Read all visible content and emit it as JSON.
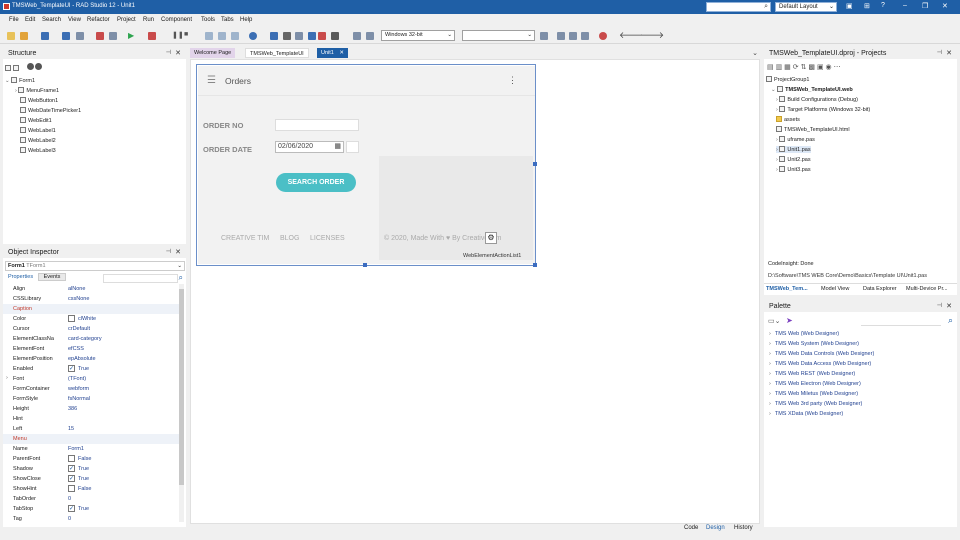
{
  "window": {
    "title": "TMSWeb_TemplateUI - RAD Studio 12 - Unit1"
  },
  "title_search": {
    "placeholder": ""
  },
  "layout": {
    "selected": "Default Layout"
  },
  "menu": [
    "File",
    "Edit",
    "Search",
    "View",
    "Refactor",
    "Project",
    "Run",
    "Component",
    "Tools",
    "Tabs",
    "Help"
  ],
  "toolbar": {
    "platform": "Windows 32-bit",
    "config": ""
  },
  "structure": {
    "title": "Structure",
    "items": [
      "Form1",
      "MenuFrame1",
      "WebButton1",
      "WebDateTimePicker1",
      "WebEdit1",
      "WebLabel1",
      "WebLabel2",
      "WebLabel3"
    ]
  },
  "object_inspector": {
    "title": "Object Inspector",
    "selected": "Form1",
    "selected_type": "TForm1",
    "tabs": [
      "Properties",
      "Events"
    ],
    "props": [
      {
        "name": "Align",
        "value": "alNone"
      },
      {
        "name": "CSSLibrary",
        "value": "cssNone"
      },
      {
        "name": "Caption",
        "value": "",
        "highlight": true
      },
      {
        "name": "Color",
        "value": "clWhite",
        "check": true
      },
      {
        "name": "Cursor",
        "value": "crDefault"
      },
      {
        "name": "ElementClassNa",
        "value": "card-category"
      },
      {
        "name": "ElementFont",
        "value": "efCSS"
      },
      {
        "name": "ElementPosition",
        "value": "epAbsolute"
      },
      {
        "name": "Enabled",
        "value": "True",
        "check": true,
        "checked": true
      },
      {
        "name": "Font",
        "value": "(TFont)",
        "expand": true
      },
      {
        "name": "FormContainer",
        "value": "webform"
      },
      {
        "name": "FormStyle",
        "value": "fsNormal"
      },
      {
        "name": "Height",
        "value": "386"
      },
      {
        "name": "Hint",
        "value": ""
      },
      {
        "name": "Left",
        "value": "15"
      },
      {
        "name": "Menu",
        "value": "",
        "highlight": true
      },
      {
        "name": "Name",
        "value": "Form1"
      },
      {
        "name": "ParentFont",
        "value": "False",
        "check": true
      },
      {
        "name": "Shadow",
        "value": "True",
        "check": true,
        "checked": true
      },
      {
        "name": "ShowClose",
        "value": "True",
        "check": true,
        "checked": true
      },
      {
        "name": "ShowHint",
        "value": "False",
        "check": true
      },
      {
        "name": "TabOrder",
        "value": "0"
      },
      {
        "name": "TabStop",
        "value": "True",
        "check": true,
        "checked": true
      },
      {
        "name": "Tag",
        "value": "0"
      }
    ]
  },
  "editor_tabs": [
    "Welcome Page",
    "TMSWeb_TemplateUI",
    "Unit1"
  ],
  "form": {
    "header_title": "Orders",
    "order_no_label": "ORDER NO",
    "order_date_label": "ORDER DATE",
    "order_date_value": "02/06/2020",
    "search_button": "SEARCH ORDER",
    "footer_links": [
      "CREATIVE TIM",
      "BLOG",
      "LICENSES"
    ],
    "copyright": "© 2020, Made With ♥ By Creative Tim",
    "action_list": "WebElementActionList1"
  },
  "bottom_tabs": [
    "Code",
    "Design",
    "History"
  ],
  "projects": {
    "title": "TMSWeb_TemplateUI.dproj - Projects",
    "items": [
      {
        "label": "ProjectGroup1",
        "indent": 0
      },
      {
        "label": "TMSWeb_TemplateUI.web",
        "indent": 1,
        "bold": true
      },
      {
        "label": "Build Configurations (Debug)",
        "indent": 2
      },
      {
        "label": "Target Platforms (Windows 32-bit)",
        "indent": 2
      },
      {
        "label": "assets",
        "indent": 2
      },
      {
        "label": "TMSWeb_TemplateUI.html",
        "indent": 2
      },
      {
        "label": "uframe.pas",
        "indent": 2
      },
      {
        "label": "Unit1.pas",
        "indent": 2,
        "selected": true
      },
      {
        "label": "Unit2.pas",
        "indent": 2
      },
      {
        "label": "Unit3.pas",
        "indent": 2
      }
    ],
    "status": "CodeInsight: Done",
    "path": "D:\\Software\\TMS WEB Core\\Demo\\Basics\\Template UI\\Unit1.pas",
    "tabs": [
      "TMSWeb_Tem...",
      "Model View",
      "Data Explorer",
      "Multi-Device Pr..."
    ]
  },
  "palette": {
    "title": "Palette",
    "items": [
      "TMS Web (Web Designer)",
      "TMS Web System (Web Designer)",
      "TMS Web Data Controls (Web Designer)",
      "TMS Web Data Access (Web Designer)",
      "TMS Web REST (Web Designer)",
      "TMS Web Electron (Web Designer)",
      "TMS Web Miletus (Web Designer)",
      "TMS Web 3rd party (Web Designer)",
      "TMS XData (Web Designer)"
    ]
  },
  "colors": {
    "title_bar": "#1f5fa6",
    "accent_button": "#4bbfc6",
    "active_tab": "#1f5fa6"
  }
}
